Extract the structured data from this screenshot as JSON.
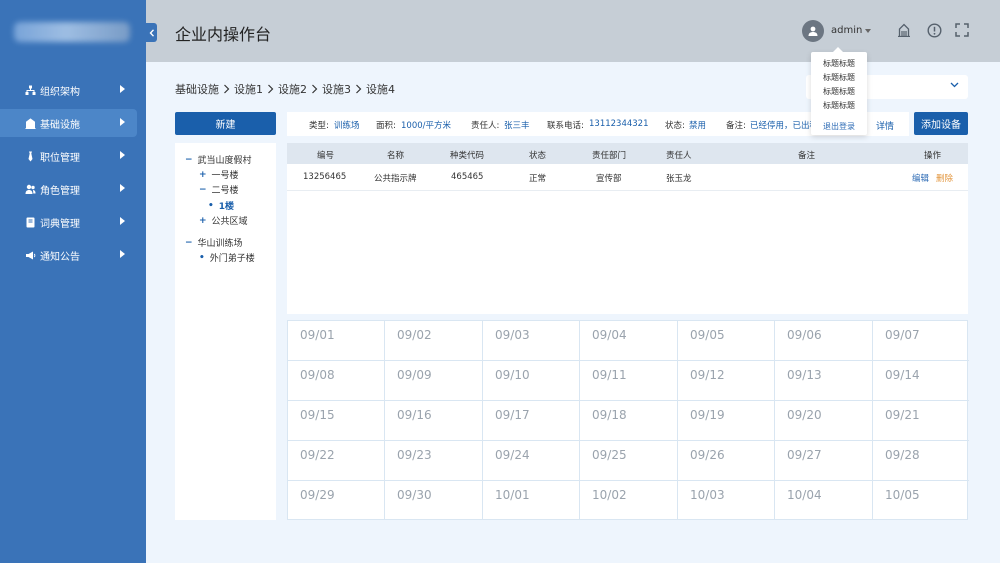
{
  "header": {
    "title": "企业内操作台",
    "username": "admin"
  },
  "user_menu": {
    "items": [
      "标题标题",
      "标题标题",
      "标题标题",
      "标题标题"
    ],
    "logout": "退出登录"
  },
  "sidebar": {
    "items": [
      {
        "label": "组织架构",
        "icon": "org-icon",
        "active": false
      },
      {
        "label": "基础设施",
        "icon": "building-icon",
        "active": true
      },
      {
        "label": "职位管理",
        "icon": "tie-icon",
        "active": false
      },
      {
        "label": "角色管理",
        "icon": "users-icon",
        "active": false
      },
      {
        "label": "词典管理",
        "icon": "book-icon",
        "active": false
      },
      {
        "label": "通知公告",
        "icon": "megaphone-icon",
        "active": false
      }
    ]
  },
  "breadcrumb": [
    "基础设施",
    "设施1",
    "设施2",
    "设施3",
    "设施4"
  ],
  "buttons": {
    "new": "新建",
    "add_device": "添加设备",
    "detail": "详情"
  },
  "tree": {
    "nodes": [
      {
        "label": "武当山度假村",
        "marker": "−",
        "level": 0
      },
      {
        "label": "一号楼",
        "marker": "+",
        "level": 1
      },
      {
        "label": "二号楼",
        "marker": "−",
        "level": 1
      },
      {
        "label": "1楼",
        "marker": "•",
        "level": 2,
        "selected": true
      },
      {
        "label": "公共区域",
        "marker": "+",
        "level": 1
      },
      {
        "label": "华山训练场",
        "marker": "−",
        "level": 0
      },
      {
        "label": "外门弟子楼",
        "marker": "•",
        "level": 1
      }
    ]
  },
  "info": {
    "type_label": "类型:",
    "type_value": "训练场",
    "area_label": "面积:",
    "area_value": "1000/平方米",
    "owner_label": "责任人:",
    "owner_value": "张三丰",
    "phone_label": "联系电话:",
    "phone_value": "13112344321",
    "status_label": "状态:",
    "status_value": "禁用",
    "remark_label": "备注:",
    "remark_value": "已经停用，已出租"
  },
  "table": {
    "columns": [
      "编号",
      "名称",
      "种类代码",
      "状态",
      "责任部门",
      "责任人",
      "备注",
      "操作"
    ],
    "rows": [
      {
        "id": "13256465",
        "name": "公共指示牌",
        "code": "465465",
        "status": "正常",
        "dept": "宣传部",
        "owner": "张玉龙",
        "remark": "",
        "edit": "编辑",
        "delete": "删除"
      }
    ]
  },
  "calendar": {
    "days": [
      "09/01",
      "09/02",
      "09/03",
      "09/04",
      "09/05",
      "09/06",
      "09/07",
      "09/08",
      "09/09",
      "09/10",
      "09/11",
      "09/12",
      "09/13",
      "09/14",
      "09/15",
      "09/16",
      "09/17",
      "09/18",
      "09/19",
      "09/20",
      "09/21",
      "09/22",
      "09/23",
      "09/24",
      "09/25",
      "09/26",
      "09/27",
      "09/28",
      "09/29",
      "09/30",
      "10/01",
      "10/02",
      "10/03",
      "10/04",
      "10/05"
    ]
  },
  "colors": {
    "sidebar": "#3a73b8",
    "primary": "#1a5fab",
    "header": "#c6ced6",
    "background": "#eef5fd",
    "delete": "#e3963e"
  }
}
